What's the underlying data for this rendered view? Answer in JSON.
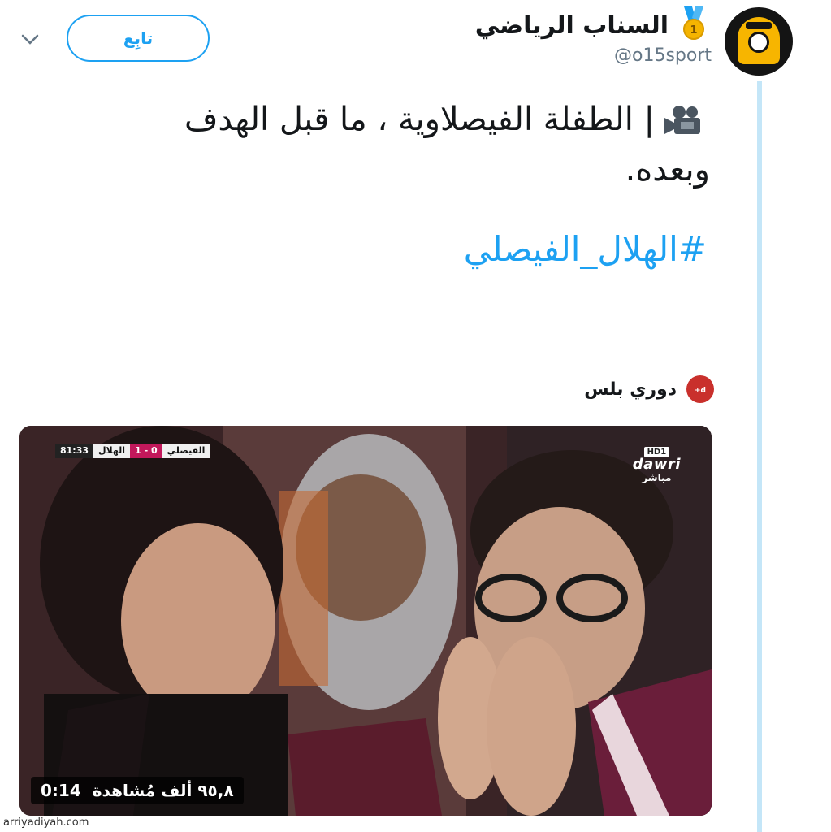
{
  "account": {
    "display_name": "السناب الرياضي",
    "handle": "@o15sport",
    "avatar_icon": "ghost-ball-logo-icon",
    "badge_icon": "medal-icon"
  },
  "follow": {
    "label": "تابِع"
  },
  "tweet": {
    "emoji_icon": "movie-camera-icon",
    "text": "| الطفلة الفيصلاوية ، ما قبل الهدف وبعده.",
    "hashtag": "#الهلال_الفيصلي"
  },
  "media_source": {
    "name": "دوري بلس",
    "logo_icon": "dawri-plus-logo-icon"
  },
  "video": {
    "score": {
      "home_team": "الفيصلي",
      "score": "0 - 1",
      "away_team": "الهلال",
      "time": "81:33"
    },
    "channel": {
      "hd": "HD1",
      "brand": "dawri",
      "status": "مباشر"
    },
    "duration": "0:14",
    "views": "٩٥,٨ ألف مُشاهدة"
  },
  "watermark": "arriyadiyah.com",
  "colors": {
    "accent": "#1da1f2",
    "thread_line": "#c4e6f8",
    "handle_gray": "#657786"
  }
}
